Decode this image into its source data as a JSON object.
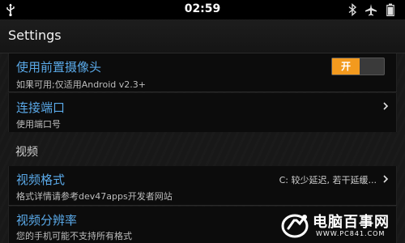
{
  "status_bar": {
    "time": "02:59",
    "icons": [
      "usb-icon",
      "bluetooth-icon",
      "airplane-mode-icon",
      "battery-icon"
    ]
  },
  "action_bar": {
    "title": "Settings"
  },
  "preferences": {
    "front_camera": {
      "title": "使用前置摄像头",
      "summary": "如果可用;仅适用Android v2.3+",
      "toggle_label": "开"
    },
    "connection_port": {
      "title": "连接端口",
      "summary": "使用端口号"
    },
    "video_section_header": "视频",
    "video_format": {
      "title": "视频格式",
      "summary": "格式详情请参考dev47apps开发者网站",
      "value": "C: 较少延迟, 若干延缓..."
    },
    "video_resolution": {
      "title": "视频分辨率",
      "summary": "您的手机可能不支持所有格式"
    }
  },
  "watermark": {
    "brand": "电脑百事网",
    "url": "WWW.PC841.COM"
  },
  "colors": {
    "accent_title": "#5aa9e8",
    "toggle_on": "#f39a1e",
    "background": "#141414"
  }
}
